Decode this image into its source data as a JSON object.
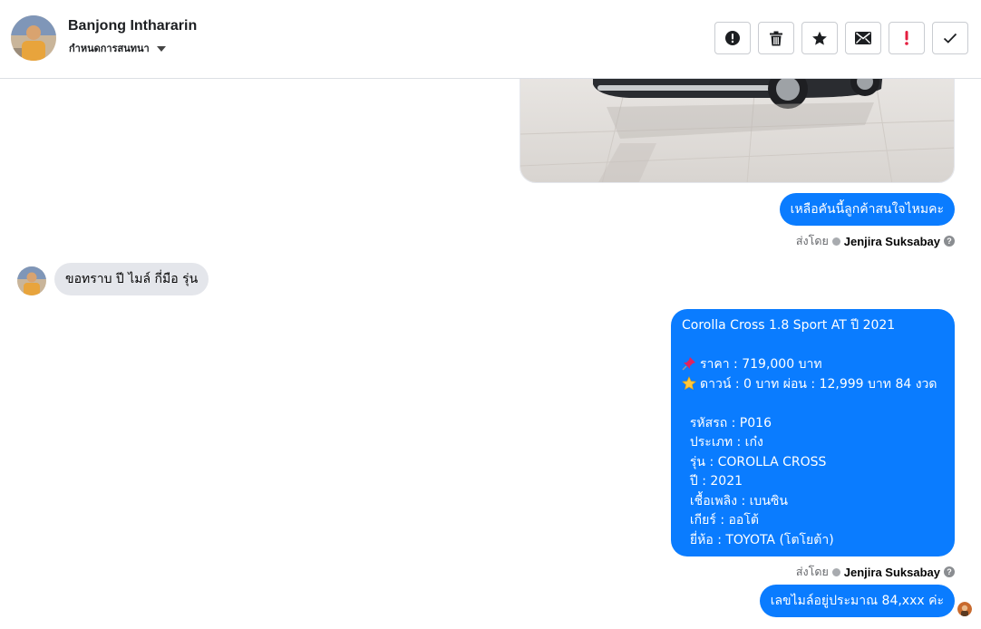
{
  "header": {
    "contact_name": "Banjong Inthararin",
    "stage_label": "กำหนดการสนทนา"
  },
  "toolbar": {
    "buttons": [
      {
        "name": "report",
        "icon": "exclamation-circle-icon"
      },
      {
        "name": "delete",
        "icon": "trash-icon"
      },
      {
        "name": "star",
        "icon": "star-icon"
      },
      {
        "name": "mark-unread",
        "icon": "envelope-icon"
      },
      {
        "name": "spam",
        "icon": "red-exclamation-icon"
      },
      {
        "name": "done",
        "icon": "checkmark-icon"
      }
    ]
  },
  "messages": {
    "m1": "เหลือคันนี้ลูกค้าสนใจไหมคะ",
    "sent_by_label": "ส่งโดย",
    "agent_name": "Jenjira Suksabay",
    "m2": "ขอทราบ ปี ไมล์ กี่มือ รุ่น",
    "m3": {
      "title": "Corolla Cross 1.8 Sport AT ปี 2021",
      "price": "ราคา : 719,000 บาท",
      "down": "ดาวน์ : 0 บาท ผ่อน : 12,999 บาท 84 งวด",
      "code": "  รหัสรถ : P016",
      "type": "  ประเภท : เก๋ง",
      "model": "  รุ่น : COROLLA CROSS",
      "year": "  ปี : 2021",
      "fuel": "  เชื้อเพลิง : เบนซิน",
      "gear": "  เกียร์ : ออโต้",
      "brand": "  ยี่ห้อ : TOYOTA (โตโยต้า)"
    },
    "m4": "เลขไมล์อยู่ประมาณ 84,xxx ค่ะ"
  },
  "colors": {
    "outgoing_bubble": "#0a7cff",
    "incoming_bubble": "#e4e6eb",
    "spam_red": "#e41e3f"
  }
}
